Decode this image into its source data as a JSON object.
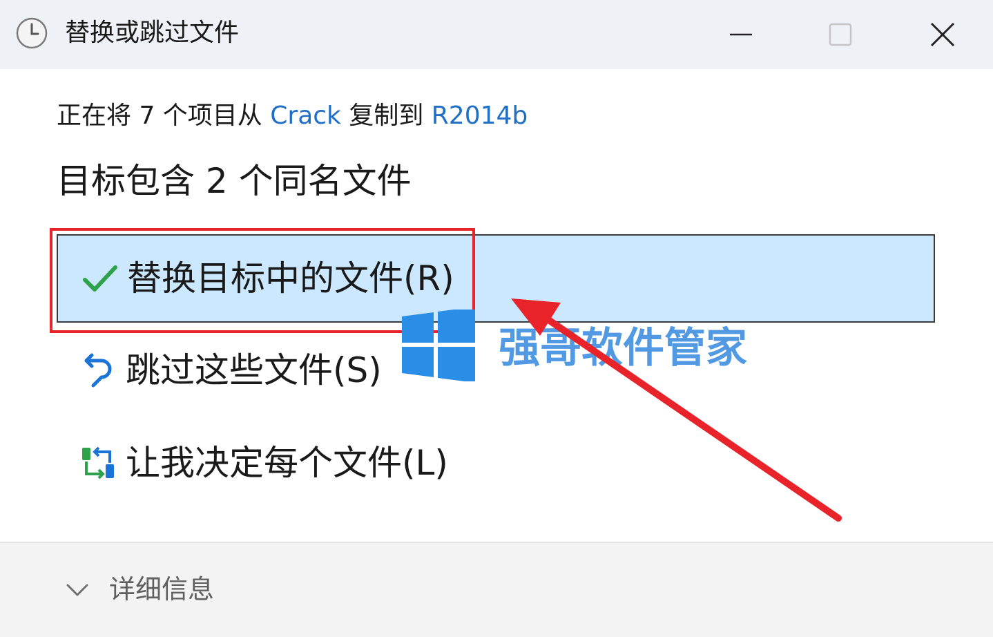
{
  "window": {
    "title": "替换或跳过文件"
  },
  "copy_info": {
    "prefix": "正在将 7 个项目从 ",
    "source": "Crack",
    "middle": " 复制到 ",
    "destination": "R2014b"
  },
  "heading": "目标包含 2 个同名文件",
  "options": [
    {
      "label": "替换目标中的文件(R)",
      "icon": "checkmark-icon",
      "selected": true
    },
    {
      "label": "跳过这些文件(S)",
      "icon": "skip-undo-icon",
      "selected": false
    },
    {
      "label": "让我决定每个文件(L)",
      "icon": "compare-files-icon",
      "selected": false
    }
  ],
  "details": {
    "label": "详细信息",
    "icon": "chevron-down-icon"
  },
  "watermark": {
    "text": "强哥软件管家",
    "logo_icon": "windows-logo-icon"
  },
  "annotation": {
    "highlight_color": "#e8232a",
    "arrow_color": "#e8232a"
  },
  "colors": {
    "link": "#1f6fc7",
    "selected_bg": "#cce8ff",
    "check_green": "#2ea24a",
    "skip_blue": "#1a73d6"
  }
}
